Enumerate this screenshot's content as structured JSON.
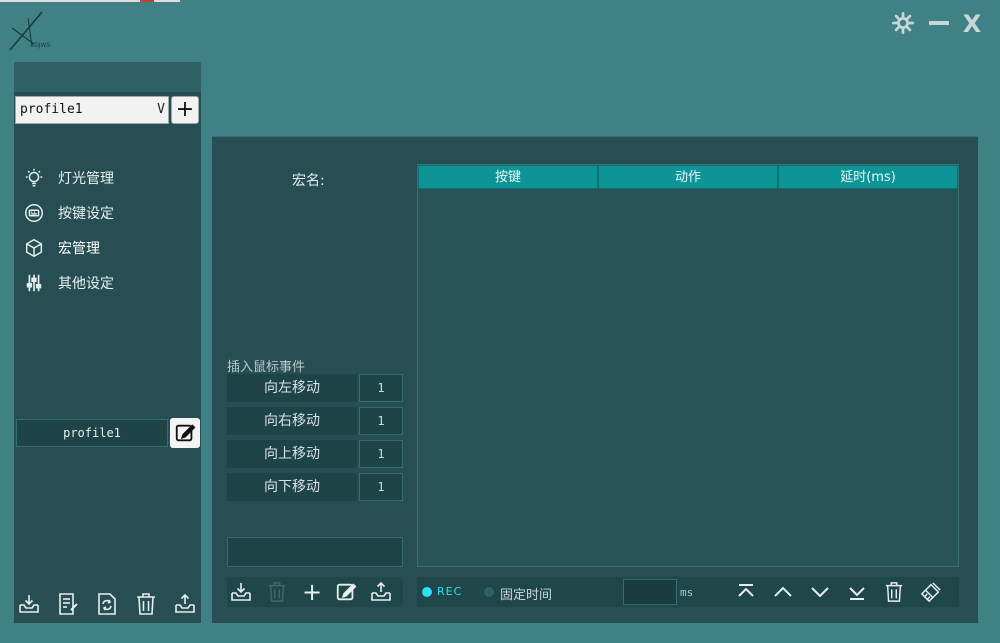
{
  "window": {
    "logo_text": "XGJWS",
    "settings_glyph": "⚙",
    "minimize_glyph": "—",
    "close_glyph": "X"
  },
  "sidebar": {
    "profile_select": {
      "value": "profile1",
      "caret": "V"
    },
    "add_profile_label": "+",
    "items": [
      {
        "label": "灯光管理",
        "icon": "lightbulb-icon"
      },
      {
        "label": "按键设定",
        "icon": "keyboard-icon"
      },
      {
        "label": "宏管理",
        "icon": "cube-icon"
      },
      {
        "label": "其他设定",
        "icon": "sliders-icon"
      }
    ],
    "profile_name": "profile1",
    "bottom_actions": [
      "import-icon",
      "document-icon",
      "refresh-icon",
      "trash-icon",
      "export-icon"
    ]
  },
  "macro": {
    "name_label": "宏名:",
    "insert_mouse_label": "插入鼠标事件",
    "moves": [
      {
        "label": "向左移动",
        "value": "1"
      },
      {
        "label": "向右移动",
        "value": "1"
      },
      {
        "label": "向上移动",
        "value": "1"
      },
      {
        "label": "向下移动",
        "value": "1"
      }
    ],
    "table_headers": [
      "按键",
      "动作",
      "延时(ms)"
    ],
    "rec_label": "REC",
    "fixed_time_label": "固定时间",
    "ms_label": "ms",
    "add_label": "+"
  },
  "colors": {
    "background": "#3f8185",
    "panel": "#274f53",
    "header": "#0c9497",
    "rec": "#2de0ef"
  }
}
